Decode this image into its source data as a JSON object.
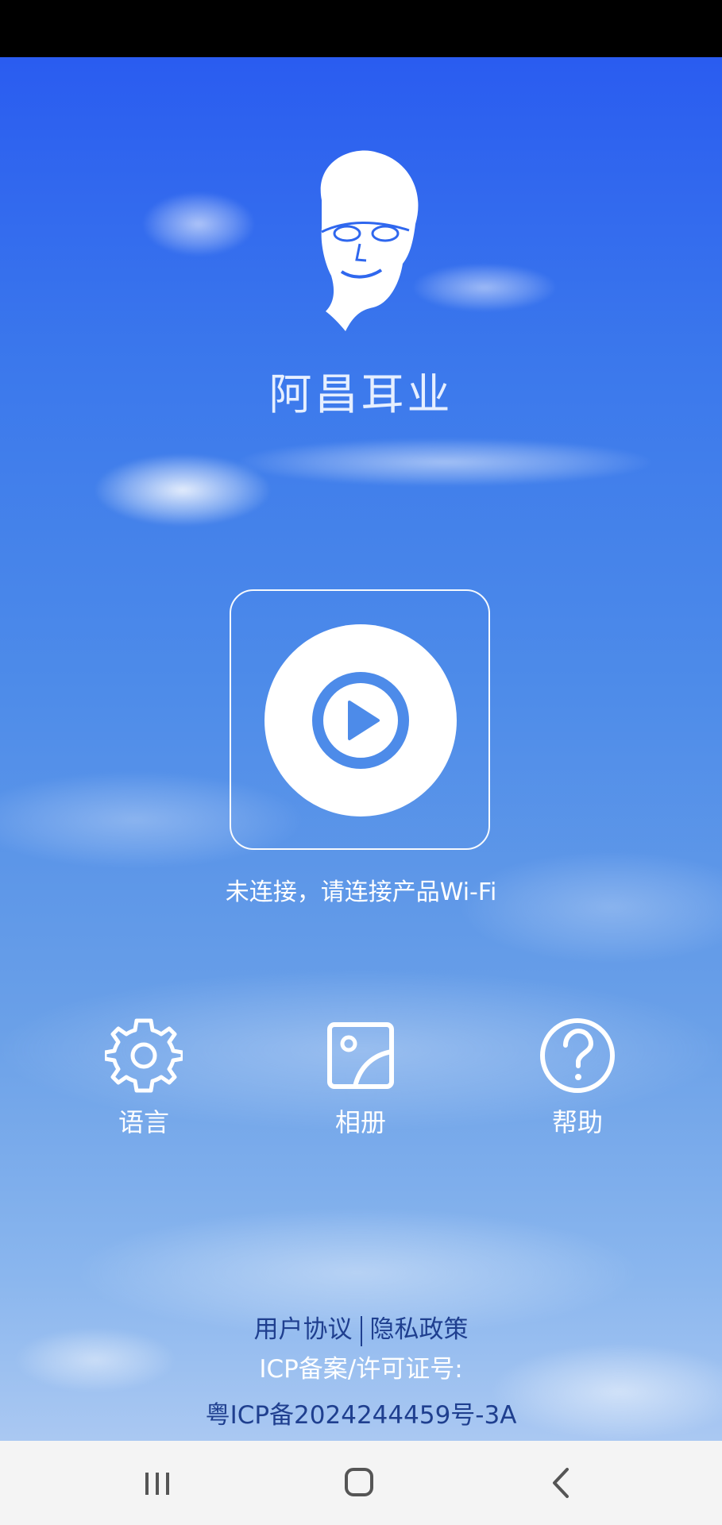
{
  "app": {
    "brand_name": "阿昌耳业"
  },
  "device": {
    "status_text": "未连接，请连接产品Wi-Fi",
    "connect_icon": "play-circle-icon"
  },
  "menu": {
    "items": [
      {
        "label": "语言",
        "icon": "gear-icon"
      },
      {
        "label": "相册",
        "icon": "photo-album-icon"
      },
      {
        "label": "帮助",
        "icon": "help-circle-icon"
      }
    ]
  },
  "footer": {
    "user_agreement": "用户协议",
    "privacy_policy": "隐私政策",
    "icp_label": "ICP备案/许可证号:",
    "icp_number": "粤ICP备2024244459号-3A"
  },
  "navigation": {
    "recent_icon": "recent-apps-icon",
    "home_icon": "home-icon",
    "back_icon": "back-icon"
  },
  "colors": {
    "sky_top": "#2a5cf0",
    "sky_bottom": "#aac8f2",
    "accent_blue": "#4d8be9",
    "link_text": "#1f3f8f"
  }
}
